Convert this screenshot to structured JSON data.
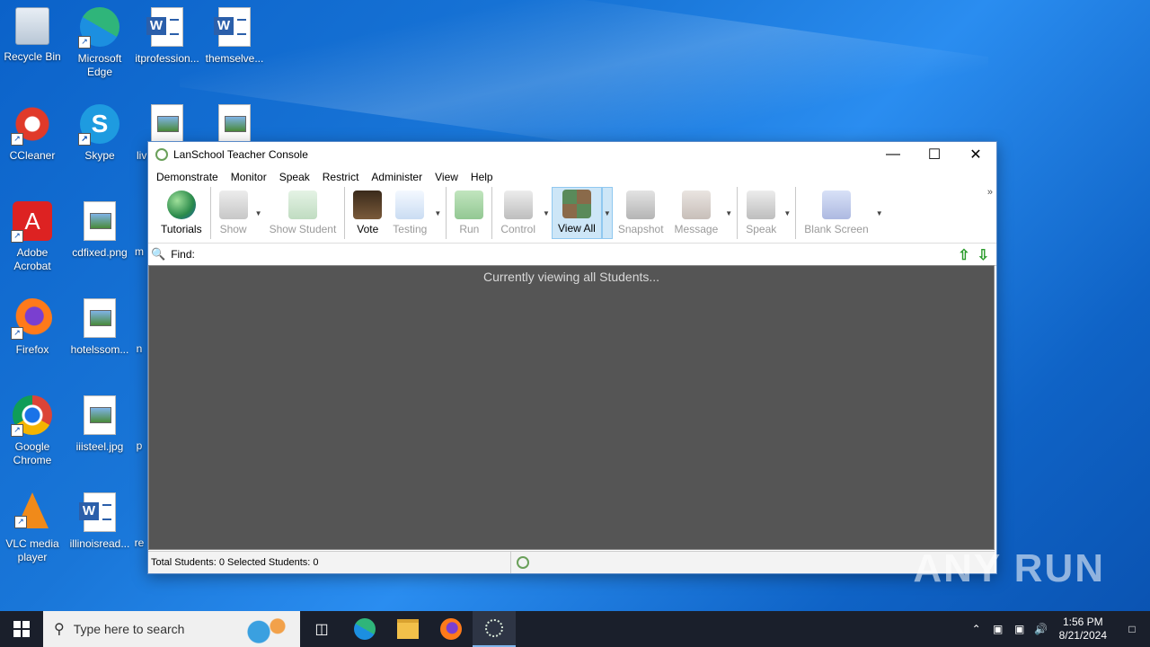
{
  "desktop": {
    "icons": [
      {
        "label": "Recycle Bin"
      },
      {
        "label": "Microsoft Edge"
      },
      {
        "label": "itprofession..."
      },
      {
        "label": "themselve..."
      },
      {
        "label": "CCleaner"
      },
      {
        "label": "Skype"
      },
      {
        "label": "liv"
      },
      {
        "label": "Adobe Acrobat"
      },
      {
        "label": "cdfixed.png"
      },
      {
        "label": "m"
      },
      {
        "label": "Firefox"
      },
      {
        "label": "hotelssom..."
      },
      {
        "label": "n"
      },
      {
        "label": "Google Chrome"
      },
      {
        "label": "iiisteel.jpg"
      },
      {
        "label": "p"
      },
      {
        "label": "VLC media player"
      },
      {
        "label": "illinoisread..."
      },
      {
        "label": "re"
      }
    ]
  },
  "window": {
    "title": "LanSchool Teacher Console",
    "menu": [
      "Demonstrate",
      "Monitor",
      "Speak",
      "Restrict",
      "Administer",
      "View",
      "Help"
    ],
    "toolbar": {
      "tutorials": "Tutorials",
      "show": "Show",
      "show_student": "Show Student",
      "vote": "Vote",
      "testing": "Testing",
      "run": "Run",
      "control": "Control",
      "view_all": "View All",
      "snapshot": "Snapshot",
      "message": "Message",
      "speak": "Speak",
      "blank_screen": "Blank Screen"
    },
    "find_label": "Find:",
    "find_value": "",
    "content_message": "Currently viewing all Students...",
    "status": "Total Students: 0  Selected Students: 0"
  },
  "watermark": "ANY RUN",
  "taskbar": {
    "search_placeholder": "Type here to search",
    "time": "1:56 PM",
    "date": "8/21/2024"
  }
}
